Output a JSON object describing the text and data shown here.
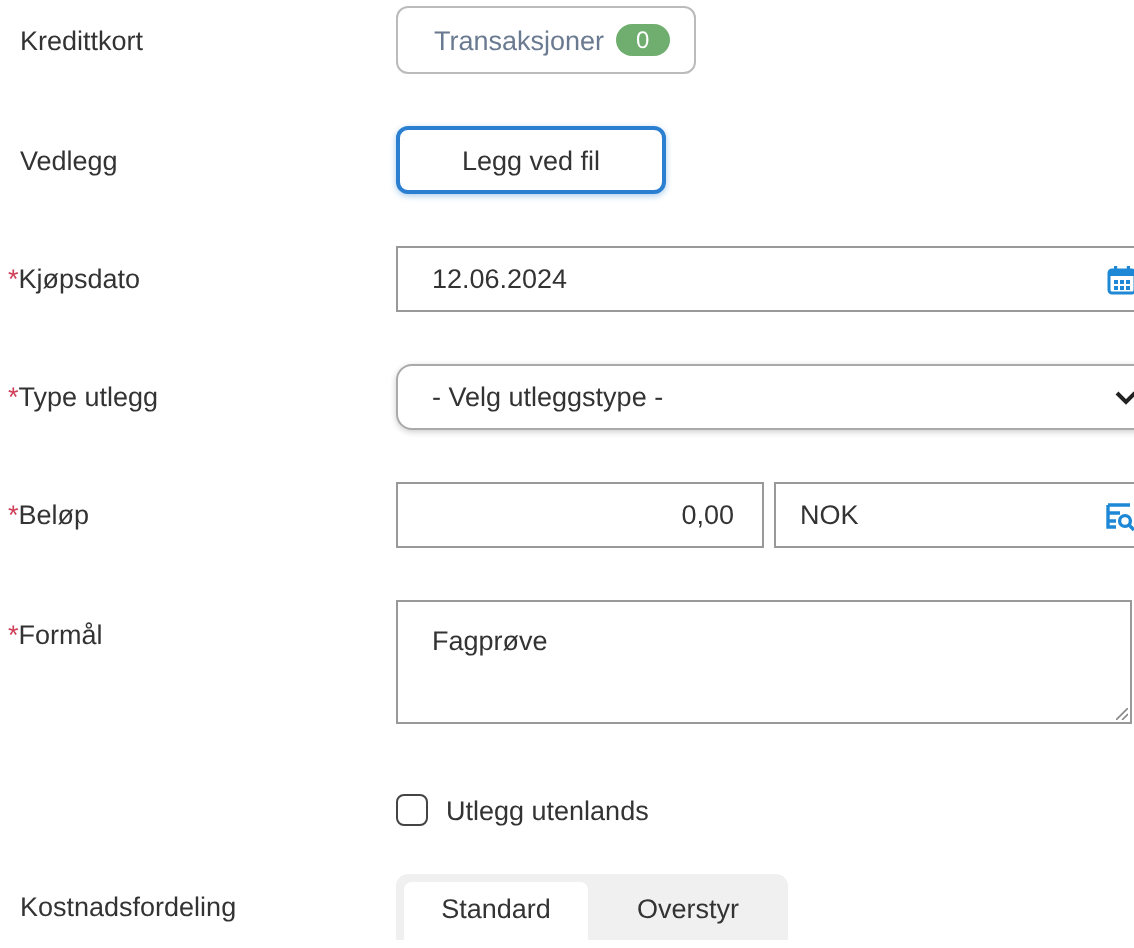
{
  "form": {
    "rows": [
      {
        "kind": "transactions",
        "label": "Kredittkort",
        "button": "Transaksjoner",
        "count": "0"
      },
      {
        "kind": "upload",
        "label": "Vedlegg",
        "button": "Legg ved fil"
      },
      {
        "kind": "date",
        "mark": "*",
        "label": "Kjøpsdato",
        "value": "12.06.2024"
      },
      {
        "kind": "select",
        "mark": "*",
        "label": "Type utlegg",
        "value": "- Velg utleggstype -"
      },
      {
        "kind": "amount",
        "mark": "*",
        "label": "Beløp",
        "value": "0,00",
        "currency": "NOK"
      },
      {
        "kind": "textarea",
        "mark": "*",
        "label": "Formål",
        "value": "Fagprøve"
      },
      {
        "kind": "checkbox",
        "label_text": "Utlegg utenlands",
        "checked": false
      },
      {
        "kind": "segmented",
        "label": "Kostnadsfordeling",
        "options": [
          {
            "label": "Standard",
            "selected": true
          },
          {
            "label": "Overstyr",
            "selected": false
          }
        ]
      }
    ]
  }
}
